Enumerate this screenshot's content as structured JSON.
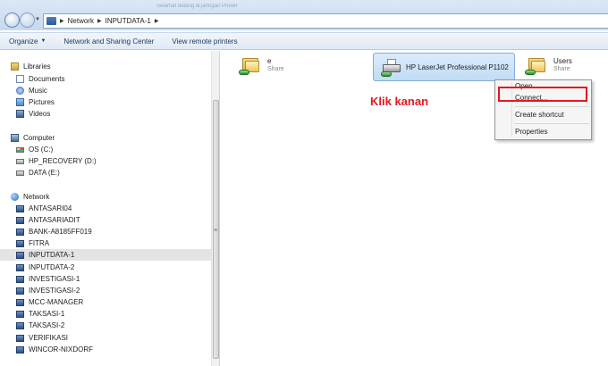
{
  "window": {
    "ghost_title": "Selamat datang di jaringan Printer",
    "ghost_title2": "Network"
  },
  "address": {
    "crumbs": [
      "Network",
      "INPUTDATA-1"
    ]
  },
  "toolbar": {
    "organize": "Organize",
    "network_center": "Network and Sharing Center",
    "view_printers": "View remote printers"
  },
  "nav": {
    "libraries": "Libraries",
    "documents": "Documents",
    "music": "Music",
    "pictures": "Pictures",
    "videos": "Videos",
    "computer": "Computer",
    "drive_c": "OS (C:)",
    "drive_d": "HP_RECOVERY (D:)",
    "drive_e": "DATA (E:)",
    "network": "Network",
    "hosts": [
      "ANTASARI04",
      "ANTASARIADIT",
      "BANK-A8185FF019",
      "FITRA",
      "INPUTDATA-1",
      "INPUTDATA-2",
      "INVESTIGASI-1",
      "INVESTIGASI-2",
      "MCC-MANAGER",
      "TAKSASI-1",
      "TAKSASI-2",
      "VERIFIKASI",
      "WINCOR-NIXDORF"
    ]
  },
  "content": {
    "share_e": {
      "name": "e",
      "sub": "Share"
    },
    "printer": {
      "name": "HP LaserJet Professional P1102"
    },
    "share_users": {
      "name": "Users",
      "sub": "Share"
    },
    "annotation": "Klik kanan"
  },
  "context_menu": {
    "open": "Open",
    "connect": "Connect...",
    "create_shortcut": "Create shortcut",
    "properties": "Properties"
  },
  "colors": {
    "annotation_red": "#e0191f",
    "selection_blue": "#c1dcf3"
  }
}
